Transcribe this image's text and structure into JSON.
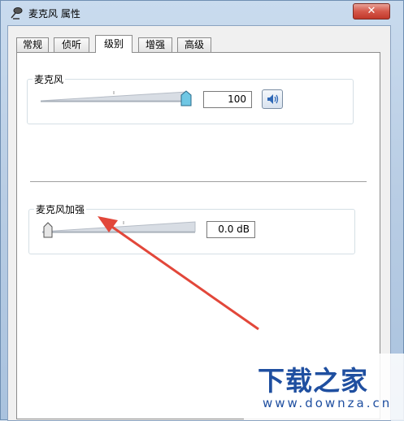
{
  "window": {
    "title": "麦克风 属性",
    "close_label": "✕"
  },
  "tabs": [
    {
      "label": "常规",
      "active": false
    },
    {
      "label": "侦听",
      "active": false
    },
    {
      "label": "级别",
      "active": true
    },
    {
      "label": "增强",
      "active": false
    },
    {
      "label": "高级",
      "active": false
    }
  ],
  "microphone": {
    "label": "麦克风",
    "value": "100",
    "level": 1.0
  },
  "boost": {
    "label": "麦克风加强",
    "value": "0.0 dB",
    "level": 0.0
  },
  "watermark": {
    "text": "下载之家",
    "url": "www.downza.cn"
  },
  "colors": {
    "arrow": "#e2473a",
    "brand": "#1f4fa0"
  },
  "icons": {
    "title": "microphone-icon",
    "speaker": "speaker-icon"
  }
}
